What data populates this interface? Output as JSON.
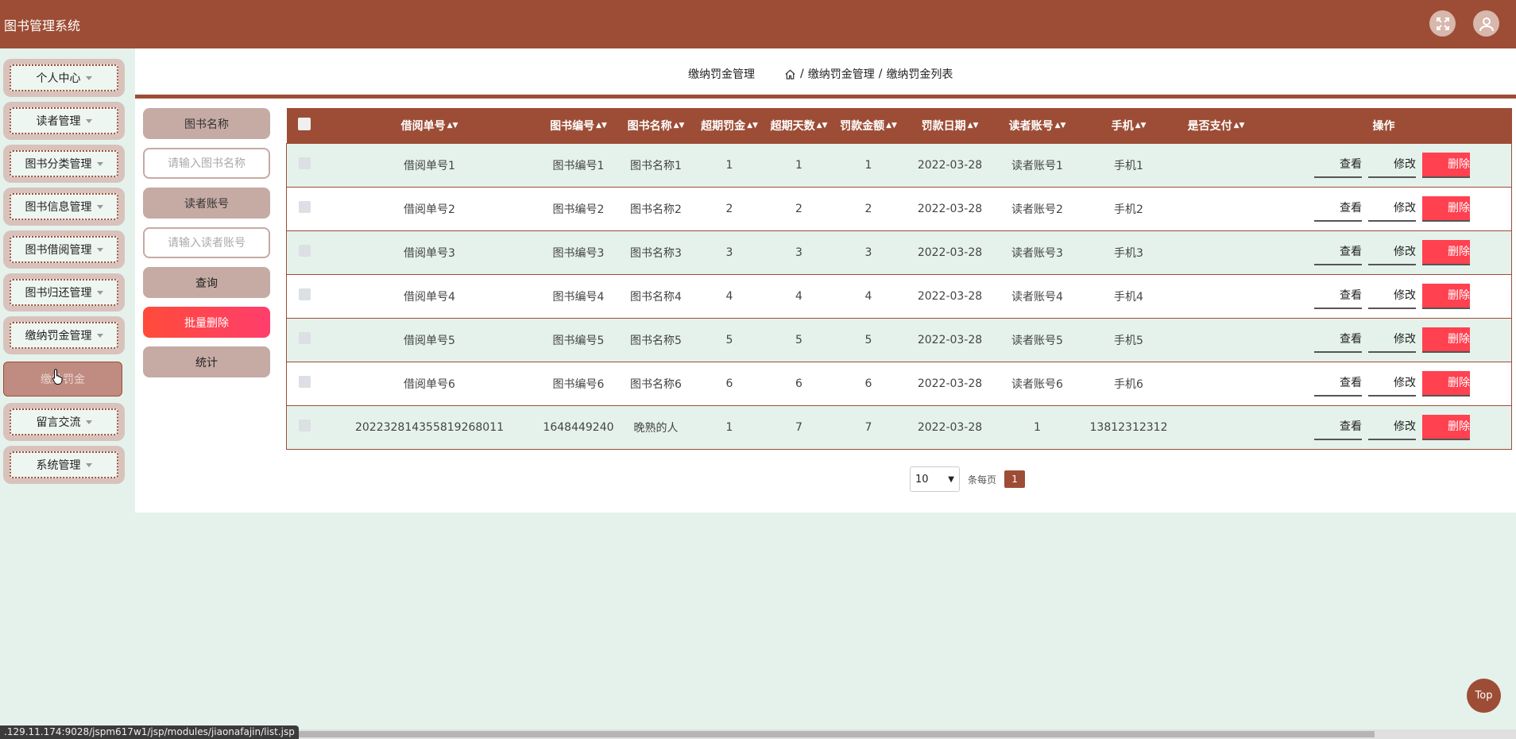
{
  "header": {
    "app_title": "图书管理系统"
  },
  "sidebar": {
    "items": [
      {
        "label": "个人中心"
      },
      {
        "label": "读者管理"
      },
      {
        "label": "图书分类管理"
      },
      {
        "label": "图书信息管理"
      },
      {
        "label": "图书借阅管理"
      },
      {
        "label": "图书归还管理"
      },
      {
        "label": "缴纳罚金管理"
      },
      {
        "label": "留言交流"
      },
      {
        "label": "系统管理"
      }
    ],
    "active_sub": "缴纳罚金"
  },
  "breadcrumb": {
    "page_title": "缴纳罚金管理",
    "sep": "/",
    "crumb1": "缴纳罚金管理",
    "crumb2": "缴纳罚金列表"
  },
  "search": {
    "book_name_label": "图书名称",
    "book_name_placeholder": "请输入图书名称",
    "reader_label": "读者账号",
    "reader_placeholder": "请输入读者账号",
    "query_btn": "查询",
    "batch_delete_btn": "批量删除",
    "stats_btn": "统计"
  },
  "table": {
    "headers": [
      "借阅单号",
      "图书编号",
      "图书名称",
      "超期罚金",
      "超期天数",
      "罚款金额",
      "罚款日期",
      "读者账号",
      "手机",
      "是否支付",
      "操作"
    ],
    "rows": [
      [
        "借阅单号1",
        "图书编号1",
        "图书名称1",
        "1",
        "1",
        "1",
        "2022-03-28",
        "读者账号1",
        "手机1",
        ""
      ],
      [
        "借阅单号2",
        "图书编号2",
        "图书名称2",
        "2",
        "2",
        "2",
        "2022-03-28",
        "读者账号2",
        "手机2",
        ""
      ],
      [
        "借阅单号3",
        "图书编号3",
        "图书名称3",
        "3",
        "3",
        "3",
        "2022-03-28",
        "读者账号3",
        "手机3",
        ""
      ],
      [
        "借阅单号4",
        "图书编号4",
        "图书名称4",
        "4",
        "4",
        "4",
        "2022-03-28",
        "读者账号4",
        "手机4",
        ""
      ],
      [
        "借阅单号5",
        "图书编号5",
        "图书名称5",
        "5",
        "5",
        "5",
        "2022-03-28",
        "读者账号5",
        "手机5",
        ""
      ],
      [
        "借阅单号6",
        "图书编号6",
        "图书名称6",
        "6",
        "6",
        "6",
        "2022-03-28",
        "读者账号6",
        "手机6",
        ""
      ],
      [
        "202232814355819268011",
        "1648449240",
        "晚熟的人",
        "1",
        "7",
        "7",
        "2022-03-28",
        "1",
        "13812312312",
        ""
      ]
    ],
    "actions": {
      "view": "查看",
      "edit": "修改",
      "delete": "删除"
    }
  },
  "pagination": {
    "page_size": "10",
    "per_page_label": "条每页",
    "current_page": "1"
  },
  "top_button": "Top",
  "status_url": ".129.11.174:9028/jspm617w1/jsp/modules/jiaonafajin/list.jsp",
  "colors": {
    "brand": "#9d4d35",
    "danger": "#ff4150",
    "background": "#e5f2ec"
  }
}
